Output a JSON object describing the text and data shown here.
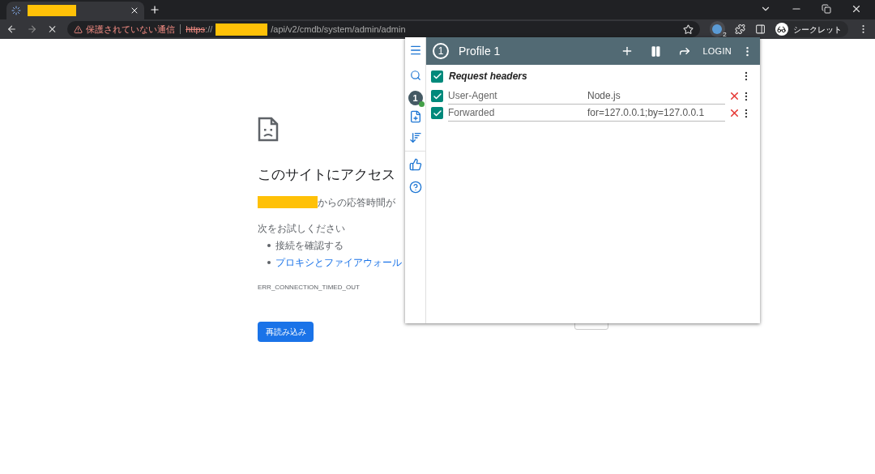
{
  "browser": {
    "address": {
      "warning": "保護されていない通信",
      "scheme": "https",
      "separator": "://",
      "path": "/api/v2/cmdb/system/admin/admin"
    },
    "extension_badge": "2",
    "profile": "シークレット"
  },
  "error_page": {
    "heading": "このサイトにアクセス",
    "message": "からの応答時間が",
    "try_label": "次をお試しください",
    "suggestions": [
      {
        "kind": "text",
        "text": "接続を確認する"
      },
      {
        "kind": "link",
        "text": "プロキシとファイアウォール"
      }
    ],
    "error_code": "ERR_CONNECTION_TIMED_OUT",
    "reload_button": "再読み込み"
  },
  "popup": {
    "profile_number": "1",
    "title": "Profile 1",
    "login": "LOGIN",
    "sidebar_badge": "1",
    "section": {
      "title": "Request headers",
      "checked": true
    },
    "headers": [
      {
        "name": "User-Agent",
        "value": "Node.js",
        "checked": true
      },
      {
        "name": "Forwarded",
        "value": "for=127.0.0.1;by=127.0.0.1",
        "checked": true
      }
    ]
  }
}
